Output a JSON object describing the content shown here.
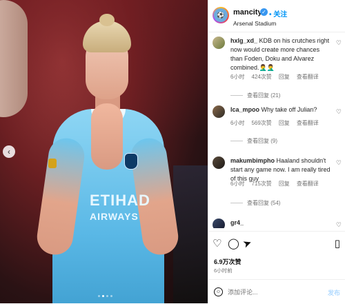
{
  "header": {
    "username": "mancity",
    "follow_label": "关注",
    "location": "Arsenal Stadium",
    "separator": "•"
  },
  "comments": [
    {
      "username": "hxlg_xd_",
      "text": "KDB on his crutches right now would create more chances than Foden, Doku and Alvarez combined.🤦‍♂️🤦‍♂️",
      "time": "6小时",
      "likes": "424次赞",
      "reply": "回复",
      "translate": "查看翻译",
      "view_replies": "查看回复 (21)"
    },
    {
      "username": "lca_mpoo",
      "text": "Why take off Julian?",
      "time": "6小时",
      "likes": "569次赞",
      "reply": "回复",
      "translate": "查看翻译",
      "view_replies": "查看回复 (9)"
    },
    {
      "username": "makumbimpho",
      "text": "Haaland shouldn't start any game now. I am really tired of this guy",
      "time": "6小时",
      "likes": "715次赞",
      "reply": "回复",
      "translate": "查看翻译",
      "view_replies": "查看回复 (54)"
    },
    {
      "username": "gr4_",
      "text": ""
    }
  ],
  "post": {
    "likes": "6.9万次赞",
    "time": "6小时前",
    "add_comment_placeholder": "添加评论...",
    "post_label": "发布"
  },
  "media": {
    "sponsor_line1": "ETIHAD",
    "sponsor_line2": "AIRWAYS"
  },
  "icons": {
    "heart": "♡",
    "comment": "◯",
    "share": "➤",
    "bookmark": "▯",
    "more": "•••",
    "prev": "‹"
  },
  "colors": {
    "accent": "#0095f6",
    "jersey": "#6cabdd",
    "muted": "#737373"
  }
}
